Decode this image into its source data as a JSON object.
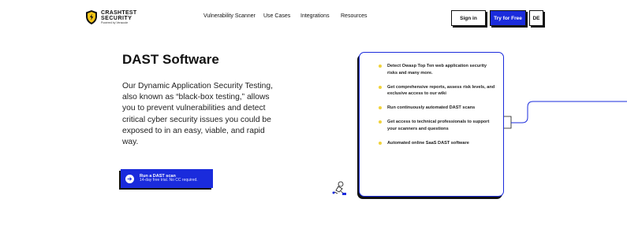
{
  "brand": {
    "line1": "CRASHTEST",
    "line2": "SECURITY",
    "line3": "Powered by Veracode",
    "shield_color": "#f5c518"
  },
  "nav": {
    "items": [
      {
        "label": "Vulnerability Scanner"
      },
      {
        "label": "Use Cases"
      },
      {
        "label": "Integrations"
      },
      {
        "label": "Resources"
      }
    ]
  },
  "header_actions": {
    "signin_label": "Sign in",
    "try_label": "Try for Free",
    "lang_label": "DE"
  },
  "hero": {
    "title": "DAST Software",
    "description": "Our Dynamic Application Security Testing, also known as “black-box testing,” allows you to prevent vulnerabilities and detect critical cyber security issues you could be exposed to in an easy, viable, and rapid way.",
    "cta_main": "Run a DAST scan",
    "cta_sub": "14-day free trial. No CC required."
  },
  "features": [
    {
      "text": "Detect Owasp Top Ten web application security risks and many more."
    },
    {
      "text": "Get comprehensive reports, assess risk levels, and exclusive access to our wiki"
    },
    {
      "text": "Run continuously automated DAST scans"
    },
    {
      "text": "Get access to technical professionals to support your scanners and questions"
    },
    {
      "text": "Automated online SaaS DAST software"
    }
  ],
  "colors": {
    "accent": "#1a2bdc",
    "bullet": "#f0d23a",
    "text": "#111111"
  }
}
